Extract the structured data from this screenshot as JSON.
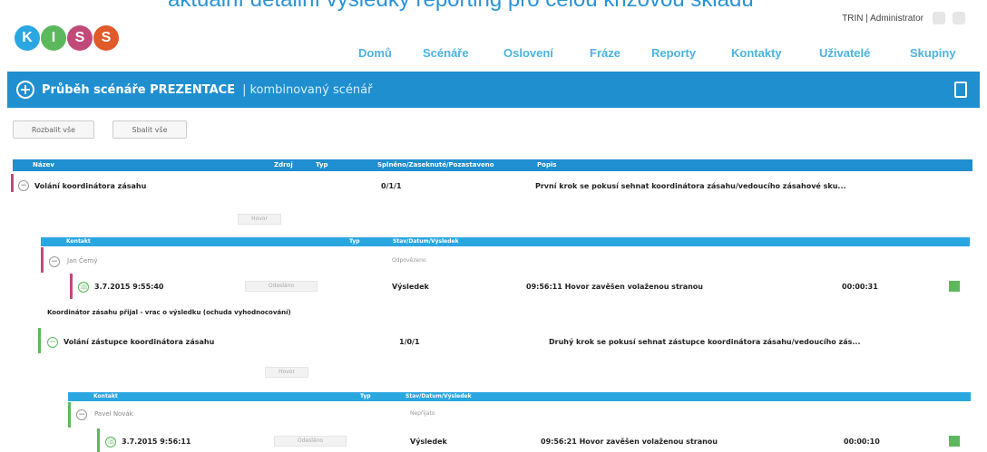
{
  "slide_title": "aktuální detailní výsledky reporting pro celou krizovou skladu",
  "user_info": "TRIN | Administrator",
  "logo_letters": [
    "K",
    "I",
    "S",
    "S"
  ],
  "nav": [
    "Domů",
    "Scénáře",
    "Oslovení",
    "Fráze",
    "Reporty",
    "Kontakty",
    "Uživatelé",
    "Skupiny"
  ],
  "header": {
    "title": "Průběh scénáře PREZENTACE",
    "separator": "|",
    "subtitle": "kombinovaný scénář"
  },
  "buttons": {
    "back": "Rozbalit vše",
    "collapse": "Sbalit vše"
  },
  "main_table": {
    "columns": [
      "Název",
      "Zdroj",
      "Typ",
      "Splněno/Zaseknuté/Pozastaveno",
      "Popis"
    ]
  },
  "groups": [
    {
      "name": "Volání koordinátora zásahu",
      "counts": "0/1/1",
      "description": "První krok se pokusí sehnat koordinátora zásahu/vedoucího zásahové sku...",
      "action_label": "Hovor",
      "sub_header": [
        "Kontakt",
        "Typ",
        "Stav/Datum/Výsledek"
      ],
      "contact": "Jan Černý",
      "contact_type": "Odpovězeno",
      "call": {
        "date": "3.7.2015 9:55:40",
        "status": "Odesláno",
        "result_type": "Výsledek",
        "detail": "09:56:11 Hovor zavěšen volaženou stranou",
        "duration": "00:00:31"
      },
      "note": "Koordinátor zásahu přijal - vrac o výsledku (ochuda vyhodnocování)"
    },
    {
      "name": "Volání zástupce koordinátora zásahu",
      "counts": "1/0/1",
      "description": "Druhý krok se pokusí sehnat zástupce koordinátora zásahu/vedoucího zás...",
      "action_label": "Hovor",
      "sub_header": [
        "Kontakt",
        "Typ",
        "Stav/Datum/Výsledek"
      ],
      "contact": "Pavel Novák",
      "contact_type": "Nepřijato",
      "call": {
        "date": "3.7.2015 9:56:11",
        "status": "Odesláno",
        "result_type": "Výsledek",
        "detail": "09:56:21 Hovor zavěšen volaženou stranou",
        "duration": "00:00:10"
      }
    }
  ],
  "colors": {
    "accent_blue": "#1f8fd0",
    "nav_blue": "#4ab3e0",
    "green": "#5cb85c",
    "pink": "#c04a7a"
  }
}
